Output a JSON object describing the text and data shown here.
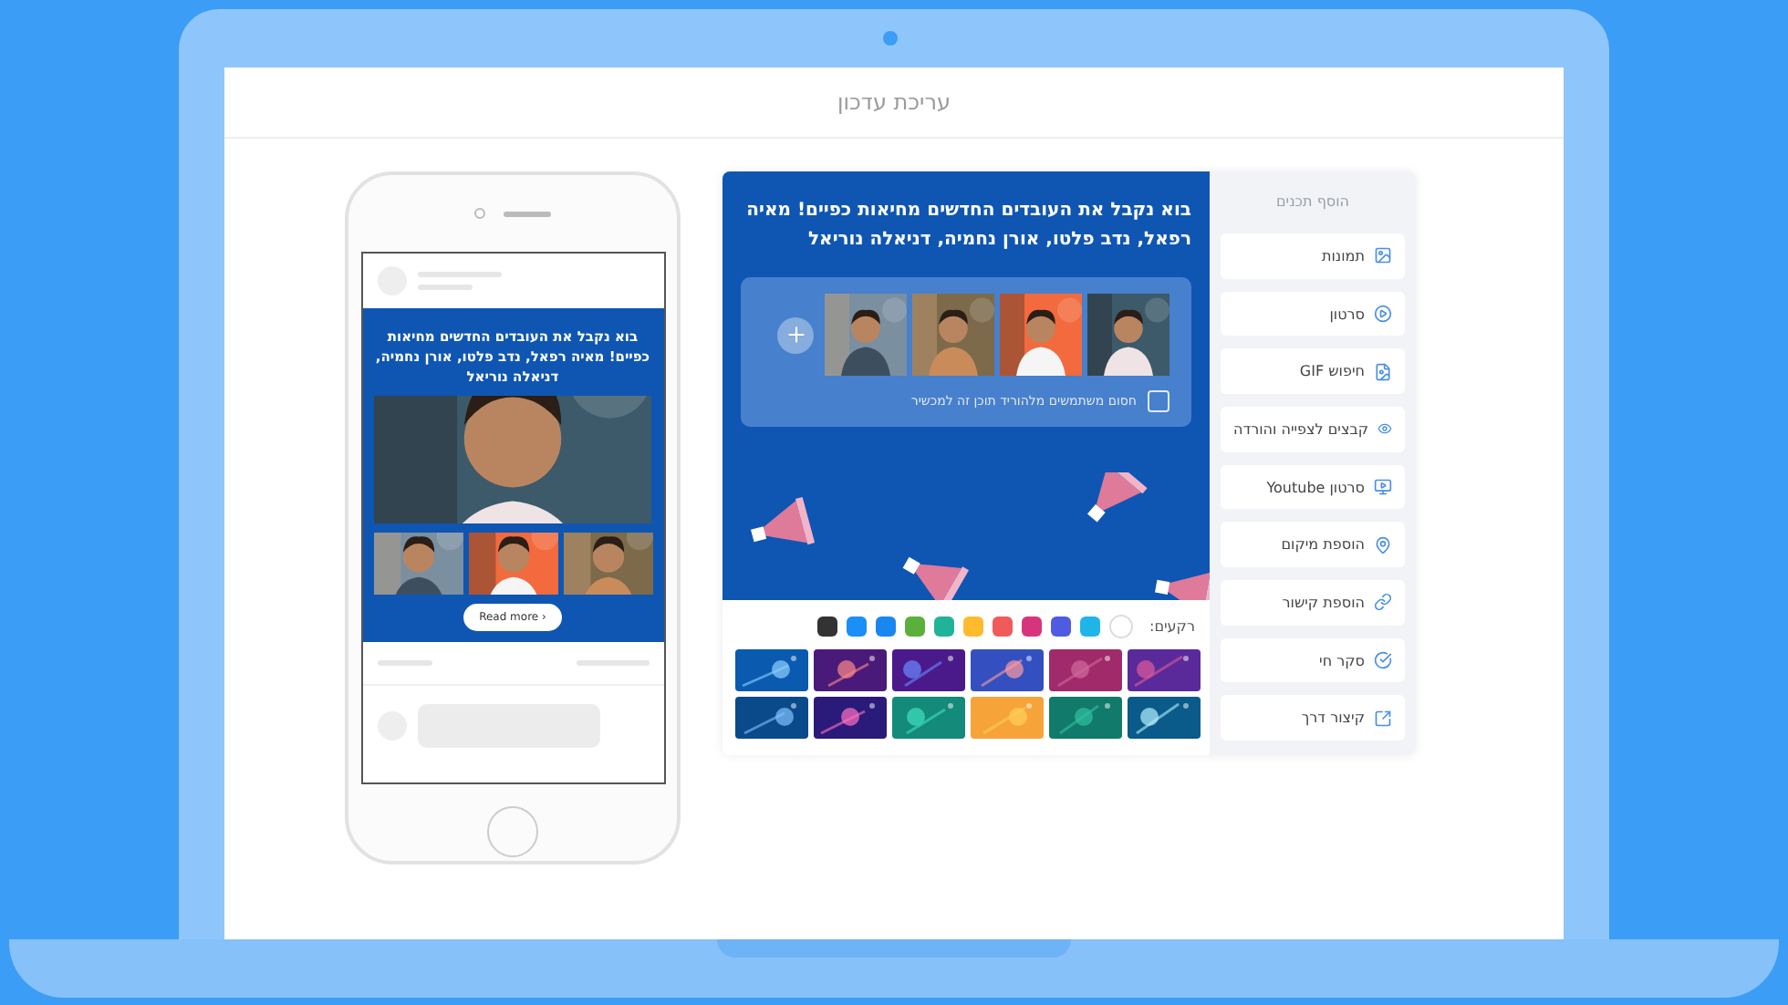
{
  "header": {
    "title": "עריכת עדכון"
  },
  "preview": {
    "post_text": "בוא נקבל את העובדים החדשים מחיאות כפיים! מאיה רפאל, נדב פלטו, אורן נחמיה, דניאלה נוריאל",
    "button": "Read more ›"
  },
  "editor": {
    "title": "בוא נקבל את העובדים החדשים מחיאות כפיים! מאיה רפאל, נדב פלטו, אורן נחמיה, דניאלה נוריאל",
    "block_download": {
      "label": "חסום משתמשים מלהוריד תוכן זה למכשיר",
      "checked": false
    },
    "backgrounds_label": "רקעים:",
    "colors": [
      {
        "color": "#ffffff"
      },
      {
        "color": "#1fb5e8"
      },
      {
        "color": "#4f5be0"
      },
      {
        "color": "#d6357e"
      },
      {
        "color": "#f05a5a"
      },
      {
        "color": "#fdbb2d"
      },
      {
        "color": "#20b39a"
      },
      {
        "color": "#5bb03c"
      },
      {
        "color": "#1a86f0"
      },
      {
        "color": "#1a8ff5"
      },
      {
        "color": "#333333"
      }
    ]
  },
  "sidebar": {
    "title": "הוסף תכנים",
    "items": [
      {
        "label": "תמונות"
      },
      {
        "label": "סרטון"
      },
      {
        "label": "חיפוש GIF"
      },
      {
        "label": "קבצים לצפייה והורדה"
      },
      {
        "label": "סרטון Youtube"
      },
      {
        "label": "הוספת מיקום"
      },
      {
        "label": "הוספת קישור"
      },
      {
        "label": "סקר חי"
      },
      {
        "label": "קיצור דרך"
      }
    ]
  }
}
